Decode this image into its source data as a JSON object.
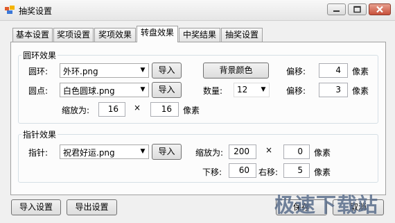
{
  "window": {
    "title": "抽奖设置"
  },
  "tabs": [
    {
      "label": "基本设置"
    },
    {
      "label": "奖项设置"
    },
    {
      "label": "奖项效果"
    },
    {
      "label": "转盘效果"
    },
    {
      "label": "中奖结果"
    },
    {
      "label": "抽奖设置"
    }
  ],
  "ring_group": {
    "title": "圆环效果",
    "ring_label": "圆环:",
    "ring_file": "外环.png",
    "dot_label": "圆点:",
    "dot_file": "白色圆球.png",
    "import_label": "导入",
    "bg_color_label": "背景颜色",
    "count_label": "数量:",
    "count_value": "12",
    "offset_label": "偏移:",
    "ring_offset": "4",
    "dot_offset": "3",
    "unit": "像素",
    "scale_label": "缩放为:",
    "scale_w": "16",
    "times": "×",
    "scale_h": "16"
  },
  "pointer_group": {
    "title": "指针效果",
    "pointer_label": "指针:",
    "pointer_file": "祝君好运.png",
    "import_label": "导入",
    "scale_label": "缩放为:",
    "scale_w": "200",
    "times": "×",
    "scale_h": "0",
    "unit": "像素",
    "down_label": "下移:",
    "down_value": "60",
    "right_label": "右移:",
    "right_value": "5"
  },
  "footer": {
    "import_settings": "导入设置",
    "export_settings": "导出设置",
    "save": "保存",
    "cancel": "取消"
  },
  "watermark": "极速下载站",
  "colors": {
    "close_button": "#c7503a",
    "group_border": "#d5dfe5"
  }
}
